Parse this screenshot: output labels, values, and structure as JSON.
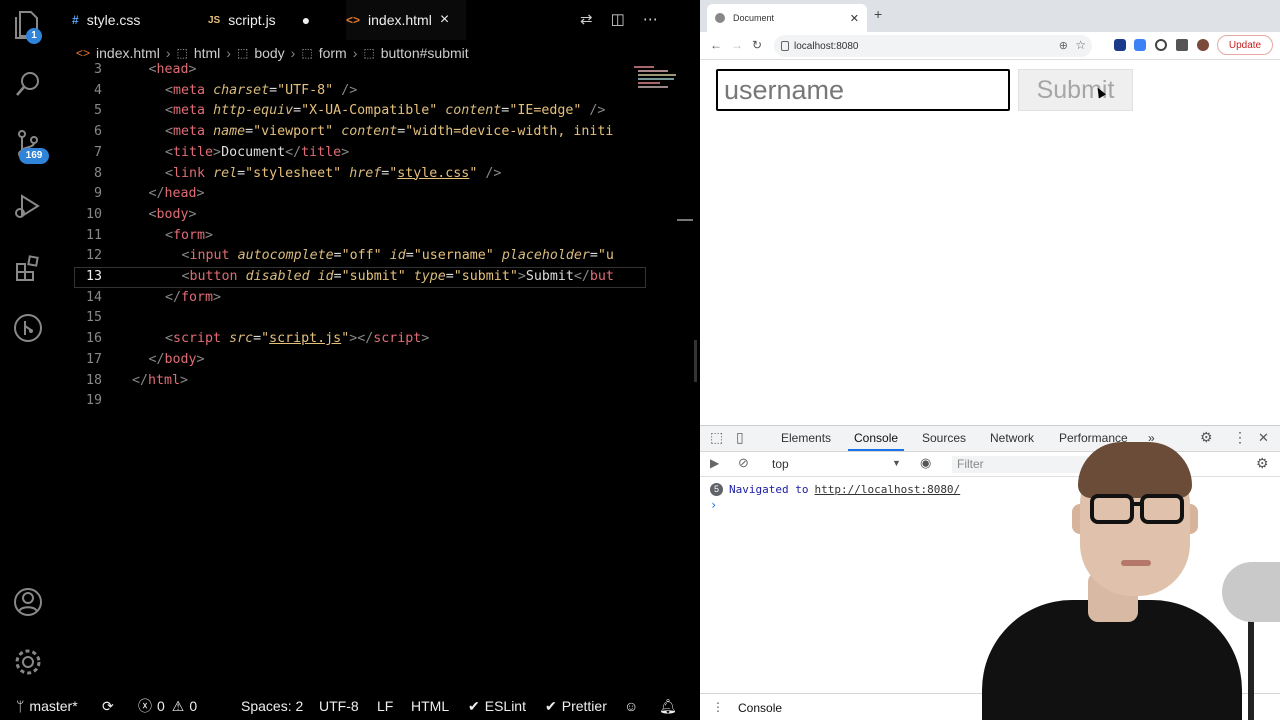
{
  "editor": {
    "activity_badges": {
      "explorer": "1",
      "source_control": "169"
    },
    "tabs": [
      {
        "icon": "#",
        "label": "style.css"
      },
      {
        "icon": "JS",
        "label": "script.js"
      },
      {
        "icon": "<>",
        "label": "index.html"
      }
    ],
    "breadcrumb": [
      "index.html",
      "html",
      "body",
      "form",
      "button#submit"
    ],
    "code_lines": [
      {
        "n": "3",
        "html": "<span class=\"tg\">&lt;</span><span class=\"tn\">head</span><span class=\"tg\">&gt;</span>",
        "indent": 1
      },
      {
        "n": "4",
        "html": "<span class=\"tg\">&lt;</span><span class=\"tn\">meta</span> <span class=\"at\">charset</span>=<span class=\"st\">\"UTF-8\"</span> <span class=\"tg\">/&gt;</span>",
        "indent": 2
      },
      {
        "n": "5",
        "html": "<span class=\"tg\">&lt;</span><span class=\"tn\">meta</span> <span class=\"at\">http-equiv</span>=<span class=\"st\">\"X-UA-Compatible\"</span> <span class=\"at\">content</span>=<span class=\"st\">\"IE=edge\"</span> <span class=\"tg\">/&gt;</span>",
        "indent": 2
      },
      {
        "n": "6",
        "html": "<span class=\"tg\">&lt;</span><span class=\"tn\">meta</span> <span class=\"at\">name</span>=<span class=\"st\">\"viewport\"</span> <span class=\"at\">content</span>=<span class=\"st\">\"width=device-width, initi</span>",
        "indent": 2
      },
      {
        "n": "7",
        "html": "<span class=\"tg\">&lt;</span><span class=\"tn\">title</span><span class=\"tg\">&gt;</span>Document<span class=\"tg\">&lt;/</span><span class=\"tn\">title</span><span class=\"tg\">&gt;</span>",
        "indent": 2
      },
      {
        "n": "8",
        "html": "<span class=\"tg\">&lt;</span><span class=\"tn\">link</span> <span class=\"at\">rel</span>=<span class=\"st\">\"stylesheet\"</span> <span class=\"at\">href</span>=<span class=\"st\">\"<span class=\"lk\">style.css</span>\"</span> <span class=\"tg\">/&gt;</span>",
        "indent": 2
      },
      {
        "n": "9",
        "html": "<span class=\"tg\">&lt;/</span><span class=\"tn\">head</span><span class=\"tg\">&gt;</span>",
        "indent": 1
      },
      {
        "n": "10",
        "html": "<span class=\"tg\">&lt;</span><span class=\"tn\">body</span><span class=\"tg\">&gt;</span>",
        "indent": 1
      },
      {
        "n": "11",
        "html": "<span class=\"tg\">&lt;</span><span class=\"tn\">form</span><span class=\"tg\">&gt;</span>",
        "indent": 2
      },
      {
        "n": "12",
        "html": "<span class=\"tg\">&lt;</span><span class=\"tn\">input</span> <span class=\"at\">autocomplete</span>=<span class=\"st\">\"off\"</span> <span class=\"at\">id</span>=<span class=\"st\">\"username\"</span> <span class=\"at\">placeholder</span>=<span class=\"st\">\"u</span>",
        "indent": 3
      },
      {
        "n": "13",
        "html": "<span class=\"tg\">&lt;</span><span class=\"tn\">button</span> <span class=\"at\">disabled</span> <span class=\"at\">id</span>=<span class=\"st\">\"submit\"</span> <span class=\"at\">type</span>=<span class=\"st\">\"submit\"</span><span class=\"tg\">&gt;</span>Submit<span class=\"tg\">&lt;/</span><span class=\"tn\">but</span>",
        "indent": 3,
        "current": true
      },
      {
        "n": "14",
        "html": "<span class=\"tg\">&lt;/</span><span class=\"tn\">form</span><span class=\"tg\">&gt;</span>",
        "indent": 2
      },
      {
        "n": "15",
        "html": "",
        "indent": 0
      },
      {
        "n": "16",
        "html": "<span class=\"tg\">&lt;</span><span class=\"tn\">script</span> <span class=\"at\">src</span>=<span class=\"st\">\"<span class=\"lk\">script.js</span>\"</span><span class=\"tg\">&gt;&lt;/</span><span class=\"tn\">script</span><span class=\"tg\">&gt;</span>",
        "indent": 2
      },
      {
        "n": "17",
        "html": "<span class=\"tg\">&lt;/</span><span class=\"tn\">body</span><span class=\"tg\">&gt;</span>",
        "indent": 1
      },
      {
        "n": "18",
        "html": "<span class=\"tg\">&lt;/</span><span class=\"tn\">html</span><span class=\"tg\">&gt;</span>",
        "indent": 0
      },
      {
        "n": "19",
        "html": "",
        "indent": 0
      }
    ],
    "status": {
      "branch": "master*",
      "errors": "0",
      "warnings": "0",
      "spaces": "Spaces: 2",
      "encoding": "UTF-8",
      "eol": "LF",
      "language": "HTML",
      "eslint": "ESLint",
      "prettier": "Prettier"
    }
  },
  "browser": {
    "tab_title": "Document",
    "address": "localhost:8080",
    "update_label": "Update",
    "page": {
      "input_placeholder": "username",
      "submit_label": "Submit"
    },
    "devtools": {
      "tabs": [
        "Elements",
        "Console",
        "Sources",
        "Network",
        "Performance"
      ],
      "active_tab": "Console",
      "context": "top",
      "filter_placeholder": "Filter",
      "messages": [
        {
          "count": "5",
          "text": "Navigated to",
          "url": "http://localhost:8080/"
        }
      ],
      "drawer_tab": "Console"
    }
  },
  "colors": {
    "badge_blue": "#2f83d8",
    "devtools_accent": "#1a73e8",
    "update_red": "#c5221f"
  }
}
